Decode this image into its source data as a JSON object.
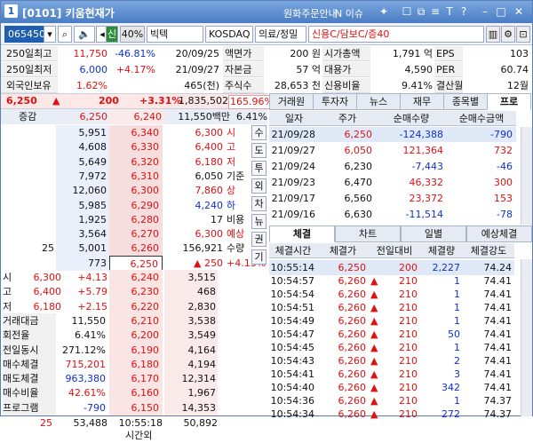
{
  "window": {
    "num": "1",
    "title": "[0101] 키움현재가",
    "notice": "원화주문안내",
    "issue": "N 이슈"
  },
  "toolbar": {
    "code": "065450",
    "m": "신",
    "rate": "40%",
    "name": "빅텍",
    "market": "KOSDAQ",
    "sector": "의료/정밀",
    "credit": "신용C/담보C/증40"
  },
  "info": {
    "rows": [
      {
        "l1": "250일최고",
        "v1": "11,750",
        "p1": "-46.81%",
        "d1": "20/09/25",
        "l2": "액면가",
        "v2": "200 원",
        "l3": "시가총액",
        "v3": "1,791 억",
        "l4": "EPS",
        "v4": "103"
      },
      {
        "l1": "250일최저",
        "v1": "6,000",
        "p1": "+4.17%",
        "d1": "21/09/27",
        "l2": "자본금",
        "v2": "57 억",
        "l3": "대용가",
        "v3": "4,590",
        "l4": "PER",
        "v4": "60.74"
      },
      {
        "l1": "외국인보유",
        "v1": "1.62%",
        "p1": "",
        "d1": "465(천)",
        "l2": "주식수",
        "v2": "28,653 천",
        "l3": "신용비율",
        "v3": "9.41%",
        "l4": "결산월",
        "v4": "12월"
      }
    ]
  },
  "price": {
    "cur": "6,250",
    "arrow": "▲",
    "chg": "200",
    "pct": "+3.31%",
    "vol": "1,835,502",
    "ratio": "165.96%"
  },
  "orderbook": {
    "head": {
      "label": "증감",
      "p1": "6,250",
      "p2": "6,240",
      "amt": "11,550백만",
      "pct": "6.41%"
    },
    "asks": [
      {
        "q": "5,951",
        "p": "6,340"
      },
      {
        "q": "4,608",
        "p": "6,330"
      },
      {
        "q": "5,649",
        "p": "6,320"
      },
      {
        "q": "7,972",
        "p": "6,310"
      },
      {
        "q": "12,060",
        "p": "6,300"
      },
      {
        "q": "5,985",
        "p": "6,290"
      },
      {
        "q": "1,925",
        "p": "6,280"
      },
      {
        "q": "3,564",
        "p": "6,270"
      },
      {
        "q": "5,001",
        "p": "6,260"
      },
      {
        "q": "773",
        "p": "6,250"
      }
    ],
    "askLeft": [
      "",
      "",
      "",
      "",
      "",
      "",
      "",
      "",
      "25",
      ""
    ],
    "side": [
      {
        "v": "6,300",
        "l": "시"
      },
      {
        "v": "6,400",
        "l": "고"
      },
      {
        "v": "6,180",
        "l": "저"
      },
      {
        "v": "6,050",
        "l": "기준"
      },
      {
        "v": "7,860",
        "l": "상"
      },
      {
        "v": "4,240",
        "l": "하"
      },
      {
        "v": "17",
        "l": "비용"
      },
      {
        "v": "6,300",
        "l": "예상"
      },
      {
        "v": "156,921",
        "l": "수량"
      },
      {
        "v": "▲ 250",
        "l": "+4.13%"
      }
    ],
    "sideBtns": [
      "수",
      "도",
      "투",
      "외",
      "차",
      "뉴",
      "권",
      "기"
    ],
    "bids": [
      {
        "p": "6,240",
        "q": "3,515"
      },
      {
        "p": "6,230",
        "q": "468"
      },
      {
        "p": "6,220",
        "q": "2,830"
      },
      {
        "p": "6,210",
        "q": "3,538"
      },
      {
        "p": "6,200",
        "q": "3,549"
      },
      {
        "p": "6,190",
        "q": "4,164"
      },
      {
        "p": "6,180",
        "q": "4,194"
      },
      {
        "p": "6,170",
        "q": "12,314"
      },
      {
        "p": "6,160",
        "q": "1,967"
      },
      {
        "p": "6,150",
        "q": "14,353"
      }
    ],
    "bidLeft": [
      {
        "l": "시",
        "v": "6,300",
        "p": "+4.13"
      },
      {
        "l": "고",
        "v": "6,400",
        "p": "+5.79"
      },
      {
        "l": "저",
        "v": "6,180",
        "p": "+2.15"
      },
      {
        "l": "거래대금",
        "v": "11,550",
        "p": ""
      },
      {
        "l": "회전율",
        "v": "6.41%",
        "p": ""
      },
      {
        "l": "전일동시",
        "v": "271.12%",
        "p": ""
      },
      {
        "l": "매수체결",
        "v": "715,201",
        "p": ""
      },
      {
        "l": "매도체결",
        "v": "963,380",
        "p": ""
      },
      {
        "l": "매수비율",
        "v": "42.61%",
        "p": ""
      },
      {
        "l": "프로그램",
        "v": "-790",
        "p": ""
      }
    ],
    "foot": {
      "a": "25",
      "b": "53,488",
      "time": "10:55:18",
      "c": "50,892",
      "after": "시간외"
    }
  },
  "rtabs": [
    "거래원",
    "투자자",
    "뉴스",
    "재무",
    "종목별",
    "프로"
  ],
  "daily": {
    "cols": [
      "일자",
      "주가",
      "순매수량",
      "순매수금액"
    ],
    "rows": [
      [
        "21/09/28",
        "6,250",
        "-124,388",
        "-790"
      ],
      [
        "21/09/27",
        "6,050",
        "121,364",
        "732"
      ],
      [
        "21/09/24",
        "6,230",
        "-7,443",
        "-46"
      ],
      [
        "21/09/23",
        "6,470",
        "46,332",
        "300"
      ],
      [
        "21/09/17",
        "6,560",
        "23,372",
        "153"
      ],
      [
        "21/09/16",
        "6,630",
        "-11,514",
        "-78"
      ]
    ]
  },
  "ttabs": [
    "체결",
    "차트",
    "일별",
    "예상체결"
  ],
  "ticks": {
    "cols": [
      "체결시간",
      "체결가",
      "전일대비",
      "체결량",
      "체결강도"
    ],
    "rows": [
      [
        "10:55:14",
        "6,250",
        "200",
        "2,227",
        "74.24"
      ],
      [
        "10:54:57",
        "6,260",
        "210",
        "1",
        "74.41"
      ],
      [
        "10:54:54",
        "6,260",
        "210",
        "1",
        "74.41"
      ],
      [
        "10:54:51",
        "6,260",
        "210",
        "1",
        "74.41"
      ],
      [
        "10:54:49",
        "6,260",
        "210",
        "1",
        "74.41"
      ],
      [
        "10:54:47",
        "6,260",
        "210",
        "50",
        "74.41"
      ],
      [
        "10:54:45",
        "6,260",
        "210",
        "1",
        "74.41"
      ],
      [
        "10:54:43",
        "6,260",
        "210",
        "2",
        "74.41"
      ],
      [
        "10:54:41",
        "6,260",
        "210",
        "3",
        "74.41"
      ],
      [
        "10:54:40",
        "6,260",
        "210",
        "342",
        "74.41"
      ],
      [
        "10:54:36",
        "6,260",
        "210",
        "1",
        "74.37"
      ],
      [
        "10:54:34",
        "6,260",
        "210",
        "272",
        "74.37"
      ]
    ]
  },
  "colors": {
    "up": "#e01010",
    "down": "#1030d0",
    "title": "#4a7cc2"
  }
}
